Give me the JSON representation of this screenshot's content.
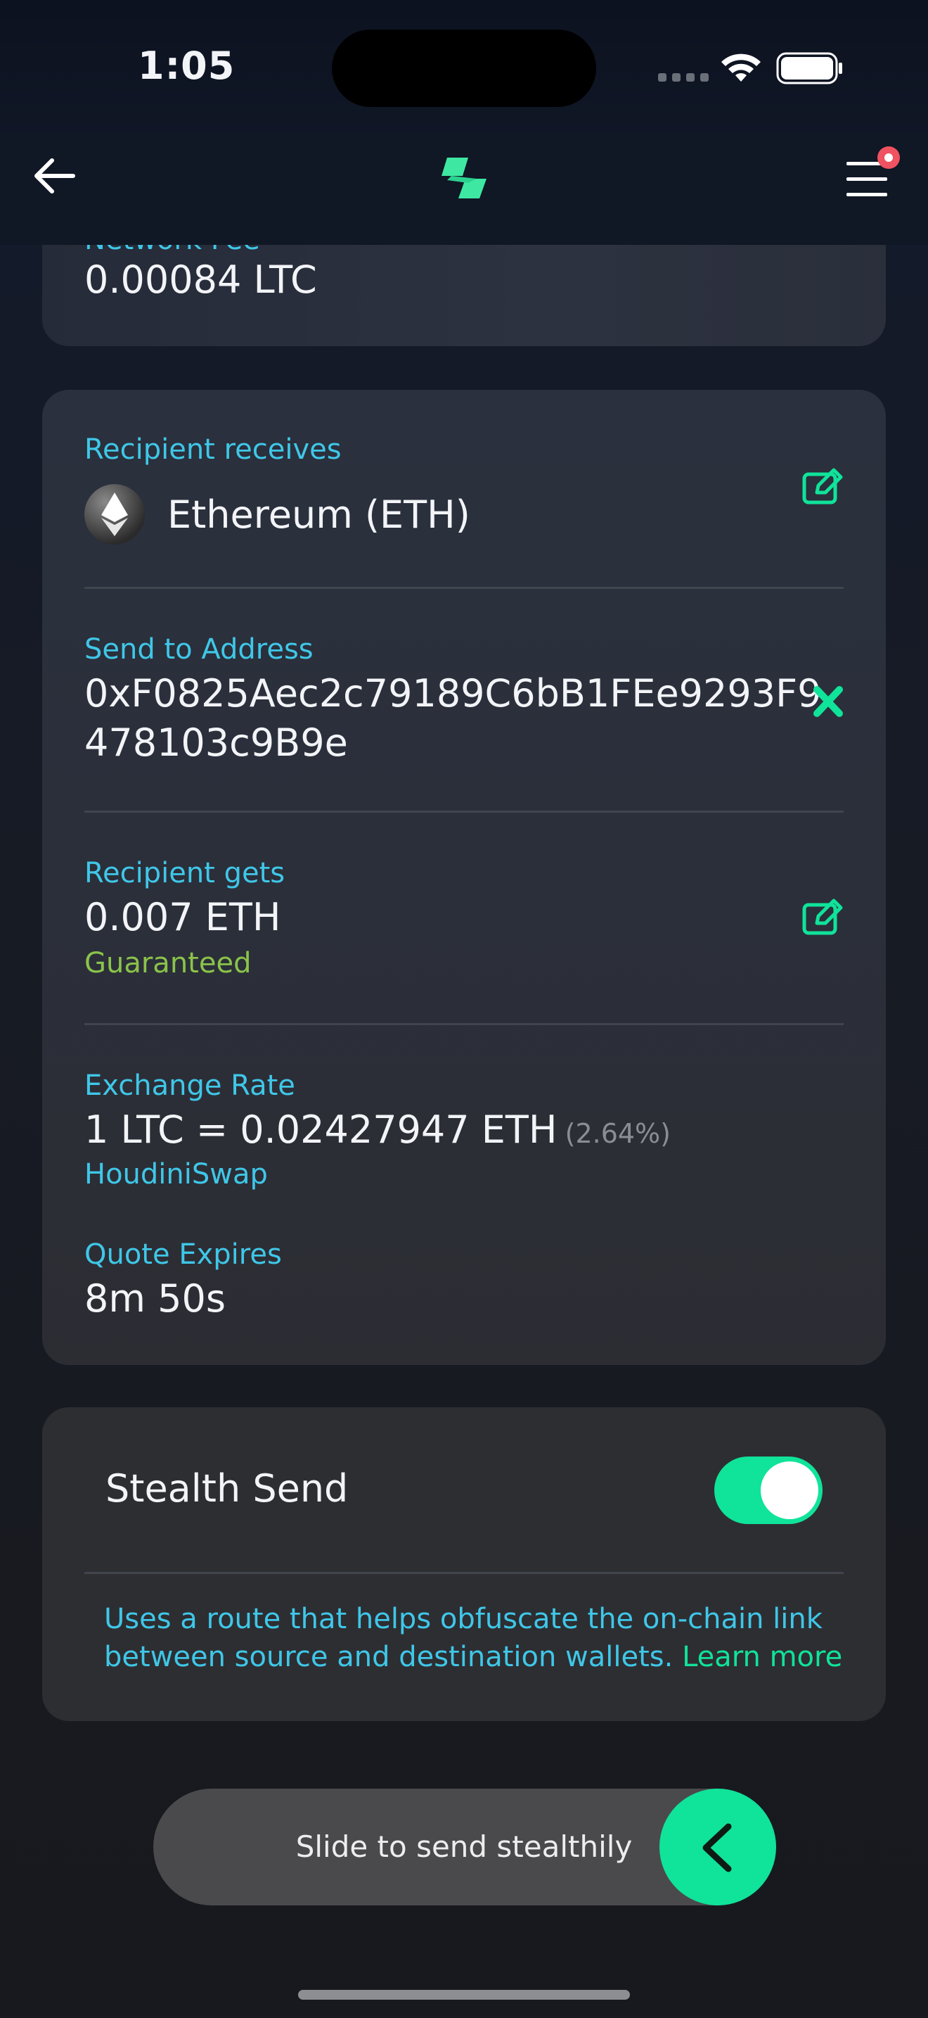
{
  "status_bar": {
    "time": "1:05"
  },
  "network_fee": {
    "label": "Network Fee",
    "value": "0.00084 LTC"
  },
  "recipient_receives": {
    "label": "Recipient receives",
    "value": "Ethereum (ETH)",
    "icon": "ethereum-icon"
  },
  "send_to_address": {
    "label": "Send to Address",
    "line1": "0xF0825Aec2c79189C6bB1FEe9293F9",
    "line2": "478103c9B9e"
  },
  "recipient_gets": {
    "label": "Recipient gets",
    "value": "0.007 ETH",
    "note": "Guaranteed"
  },
  "exchange_rate": {
    "label": "Exchange Rate",
    "value": "1 LTC = 0.02427947 ETH",
    "percent": "(2.64%)",
    "provider": "HoudiniSwap"
  },
  "quote_expires": {
    "label": "Quote Expires",
    "value": "8m 50s"
  },
  "stealth_send": {
    "label": "Stealth Send",
    "enabled": true,
    "desc_line1": "Uses a route that helps obfuscate the on-chain link",
    "desc_line2": "between source and destination wallets.",
    "learn_more": "Learn more"
  },
  "slider": {
    "label": "Slide to send stealthily"
  },
  "colors": {
    "accent": "#10e39a",
    "label": "#3fc7e8",
    "guaranteed": "#8bc34a",
    "muted": "#8a8d94"
  }
}
